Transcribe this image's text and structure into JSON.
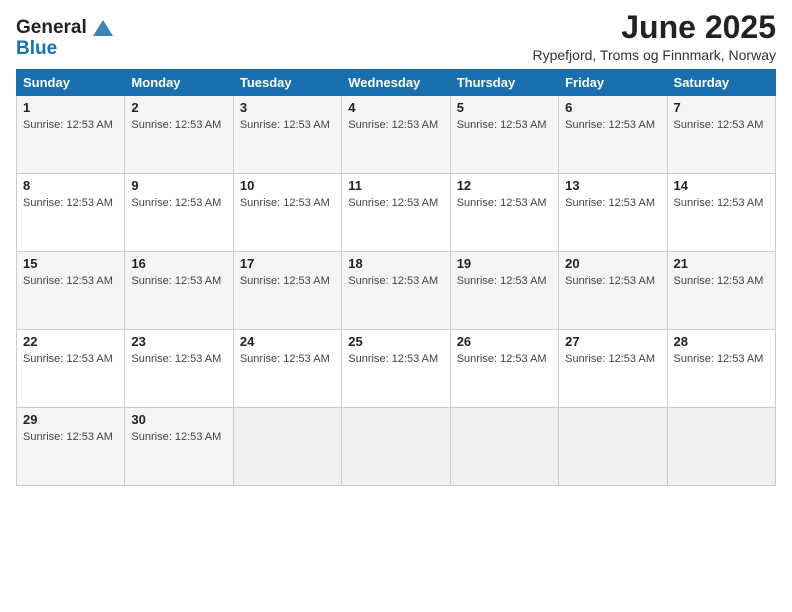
{
  "logo": {
    "line1": "General",
    "line2": "Blue"
  },
  "title": "June 2025",
  "location": "Rypefjord, Troms og Finnmark, Norway",
  "days_of_week": [
    "Sunday",
    "Monday",
    "Tuesday",
    "Wednesday",
    "Thursday",
    "Friday",
    "Saturday"
  ],
  "sunrise_time": "12:53 AM",
  "weeks": [
    [
      {
        "day": "1",
        "sunrise": "Sunrise: 12:53 AM"
      },
      {
        "day": "2",
        "sunrise": "Sunrise: 12:53 AM"
      },
      {
        "day": "3",
        "sunrise": "Sunrise: 12:53 AM"
      },
      {
        "day": "4",
        "sunrise": "Sunrise: 12:53 AM"
      },
      {
        "day": "5",
        "sunrise": "Sunrise: 12:53 AM"
      },
      {
        "day": "6",
        "sunrise": "Sunrise: 12:53 AM"
      },
      {
        "day": "7",
        "sunrise": "Sunrise: 12:53 AM"
      }
    ],
    [
      {
        "day": "8",
        "sunrise": "Sunrise: 12:53 AM"
      },
      {
        "day": "9",
        "sunrise": "Sunrise: 12:53 AM"
      },
      {
        "day": "10",
        "sunrise": "Sunrise: 12:53 AM"
      },
      {
        "day": "11",
        "sunrise": "Sunrise: 12:53 AM"
      },
      {
        "day": "12",
        "sunrise": "Sunrise: 12:53 AM"
      },
      {
        "day": "13",
        "sunrise": "Sunrise: 12:53 AM"
      },
      {
        "day": "14",
        "sunrise": "Sunrise: 12:53 AM"
      }
    ],
    [
      {
        "day": "15",
        "sunrise": "Sunrise: 12:53 AM"
      },
      {
        "day": "16",
        "sunrise": "Sunrise: 12:53 AM"
      },
      {
        "day": "17",
        "sunrise": "Sunrise: 12:53 AM"
      },
      {
        "day": "18",
        "sunrise": "Sunrise: 12:53 AM"
      },
      {
        "day": "19",
        "sunrise": "Sunrise: 12:53 AM"
      },
      {
        "day": "20",
        "sunrise": "Sunrise: 12:53 AM"
      },
      {
        "day": "21",
        "sunrise": "Sunrise: 12:53 AM"
      }
    ],
    [
      {
        "day": "22",
        "sunrise": "Sunrise: 12:53 AM"
      },
      {
        "day": "23",
        "sunrise": "Sunrise: 12:53 AM"
      },
      {
        "day": "24",
        "sunrise": "Sunrise: 12:53 AM"
      },
      {
        "day": "25",
        "sunrise": "Sunrise: 12:53 AM"
      },
      {
        "day": "26",
        "sunrise": "Sunrise: 12:53 AM"
      },
      {
        "day": "27",
        "sunrise": "Sunrise: 12:53 AM"
      },
      {
        "day": "28",
        "sunrise": "Sunrise: 12:53 AM"
      }
    ],
    [
      {
        "day": "29",
        "sunrise": "Sunrise: 12:53 AM"
      },
      {
        "day": "30",
        "sunrise": "Sunrise: 12:53 AM"
      },
      null,
      null,
      null,
      null,
      null
    ]
  ],
  "colors": {
    "header_bg": "#1a6faf",
    "odd_row_bg": "#f5f5f5",
    "even_row_bg": "#ffffff",
    "empty_bg": "#eeeeee"
  }
}
